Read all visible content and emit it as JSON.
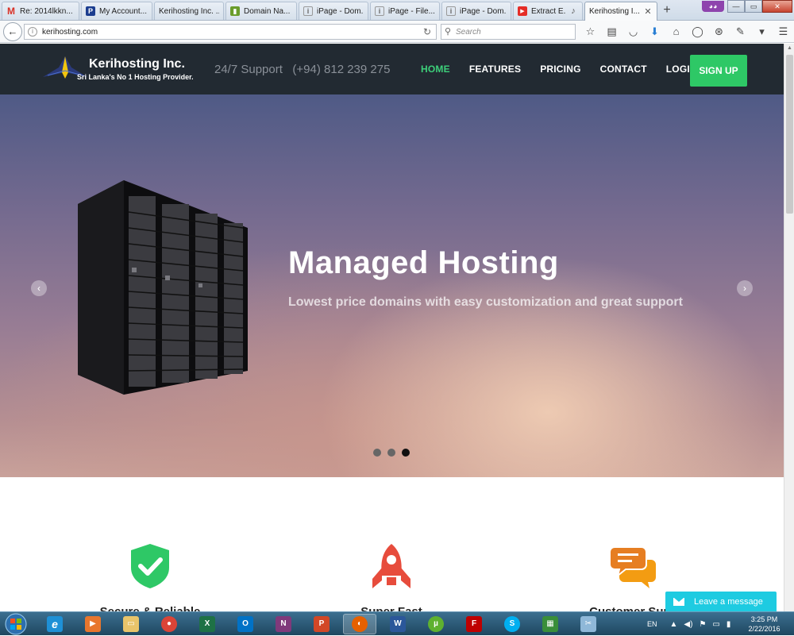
{
  "browser": {
    "tabs": [
      {
        "label": "Re: 2014lkkn...",
        "icon": "gmail-icon",
        "active": false
      },
      {
        "label": "My Account...",
        "icon": "paypal-icon",
        "active": false
      },
      {
        "label": "Kerihosting Inc. ...",
        "icon": "page-icon",
        "active": false
      },
      {
        "label": "Domain Na...",
        "icon": "domain-icon",
        "active": false
      },
      {
        "label": "iPage - Dom...",
        "icon": "ipage-icon",
        "active": false
      },
      {
        "label": "iPage - File...",
        "icon": "ipage-icon",
        "active": false
      },
      {
        "label": "iPage - Dom...",
        "icon": "ipage-icon",
        "active": false
      },
      {
        "label": "Extract E...",
        "icon": "youtube-icon",
        "active": false
      },
      {
        "label": "Kerihosting I...",
        "icon": "page-icon",
        "active": true
      }
    ],
    "new_tab": "+",
    "url": "kerihosting.com",
    "search_placeholder": "Search"
  },
  "site": {
    "brand": "Kerihosting Inc.",
    "tagline": "Sri Lanka's No 1 Hosting Provider.",
    "support_text": "24/7 Support   (+94) 812 239 275",
    "menu": [
      {
        "label": "HOME",
        "active": true
      },
      {
        "label": "FEATURES",
        "active": false
      },
      {
        "label": "PRICING",
        "active": false
      },
      {
        "label": "CONTACT",
        "active": false
      },
      {
        "label": "LOGIN",
        "active": false
      }
    ],
    "signup_label": "SIGN UP",
    "accent_color": "#2ec866"
  },
  "hero": {
    "title": "Managed Hosting",
    "subtitle": "Lowest price domains with easy customization and great support",
    "slides_total": 3,
    "active_slide": 3
  },
  "features": [
    {
      "title": "Secure & Reliable",
      "icon": "shield-check-icon",
      "color": "#2ec866"
    },
    {
      "title": "Super Fast",
      "icon": "rocket-icon",
      "color": "#e74c3c"
    },
    {
      "title": "Customer Supp",
      "icon": "chat-bubbles-icon",
      "color": "#f39c12"
    }
  ],
  "chat": {
    "label": "Leave a message"
  },
  "taskbar": {
    "apps": [
      "ie-icon",
      "media-player-icon",
      "explorer-icon",
      "chrome-icon",
      "excel-icon",
      "outlook-icon",
      "onenote-icon",
      "powerpoint-icon",
      "firefox-icon",
      "word-icon",
      "utorrent-icon",
      "filezilla-icon",
      "skype-icon",
      "excel-alt-icon",
      "snipping-icon"
    ],
    "language": "EN",
    "time": "3:25 PM",
    "date": "2/22/2016"
  }
}
